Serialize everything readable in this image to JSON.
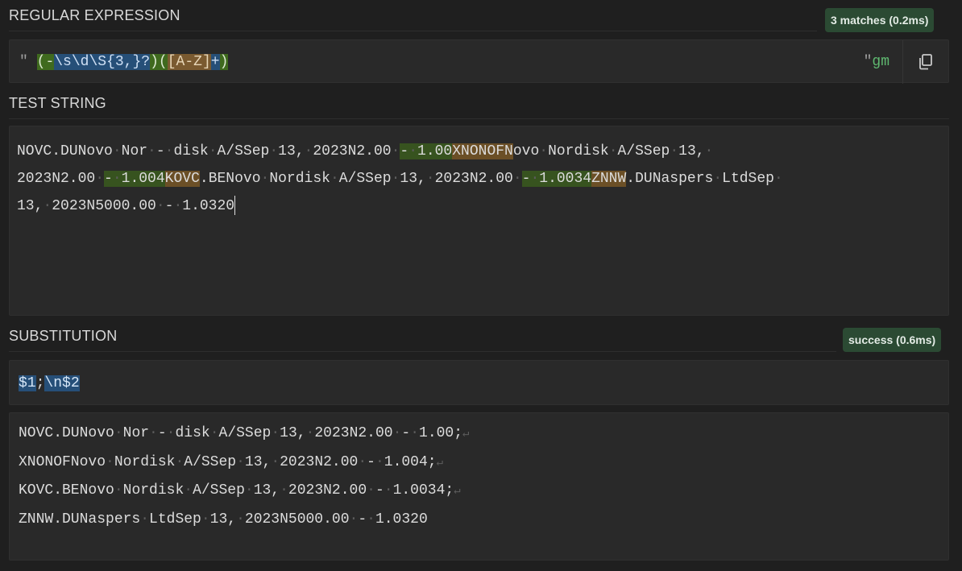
{
  "regex": {
    "title": "REGULAR EXPRESSION",
    "matches_badge": "3 matches (0.2ms)",
    "open_delim": "\"",
    "close_delim": "\"",
    "tokens": {
      "g1_open": "(",
      "dash": "-",
      "ws": "\\s",
      "digit": "\\d",
      "nonws": "\\S",
      "rep": "{3,}",
      "lazy": "?",
      "g1_close": ")",
      "g2_open": "(",
      "class": "[A-Z]",
      "plus": "+",
      "g2_close": ")"
    },
    "flags": "gm",
    "copy_icon": "copy-icon"
  },
  "test": {
    "title": "TEST STRING",
    "line1": {
      "a": "NOVC.DUNovo",
      "b": "Nor",
      "c": "-",
      "d": "disk",
      "e": "A/SSep",
      "f": "13,",
      "g": "2023N2.00",
      "m1_a": "-",
      "m1_b": "1.00",
      "m2": "XNONOFN",
      "h": "ovo",
      "i": "Nordisk",
      "j": "A/SSep",
      "k": "13,"
    },
    "line2": {
      "a": "2023N2.00",
      "m1_a": "-",
      "m1_b": "1.004",
      "m2": "KOVC",
      "b": ".BENovo",
      "c": "Nordisk",
      "d": "A/SSep",
      "e": "13,",
      "f": "2023N2.00",
      "m1b_a": "-",
      "m1b_b": "1.0034",
      "m2b": "ZNNW",
      "g": ".DUNaspers",
      "h": "LtdSep"
    },
    "line3": {
      "a": "13,",
      "b": "2023N5000.00",
      "c": "-",
      "d": "1.0320"
    }
  },
  "substitution": {
    "title": "SUBSTITUTION",
    "badge": "success (0.6ms)",
    "t1": "$1",
    "semi": ";",
    "t2": "\\n",
    "t3": "$2"
  },
  "result": {
    "l1": [
      "NOVC.DUNovo",
      "Nor",
      "-",
      "disk",
      "A/SSep",
      "13,",
      "2023N2.00",
      "-",
      "1.00;"
    ],
    "l2": [
      "XNONOFNovo",
      "Nordisk",
      "A/SSep",
      "13,",
      "2023N2.00",
      "-",
      "1.004;"
    ],
    "l3": [
      "KOVC.BENovo",
      "Nordisk",
      "A/SSep",
      "13,",
      "2023N2.00",
      "-",
      "1.0034;"
    ],
    "l4": [
      "ZNNW.DUNaspers",
      "LtdSep",
      "13,",
      "2023N5000.00",
      "-",
      "1.0320"
    ],
    "newline_mark": "↵"
  },
  "colors": {
    "background": "#1f1f1f",
    "panel": "#292929",
    "badge": "#2b4a33",
    "group1_match": "#37531f",
    "group2_match": "#6b4f26",
    "token_blue": "#264f78",
    "flags": "#5fb870"
  }
}
